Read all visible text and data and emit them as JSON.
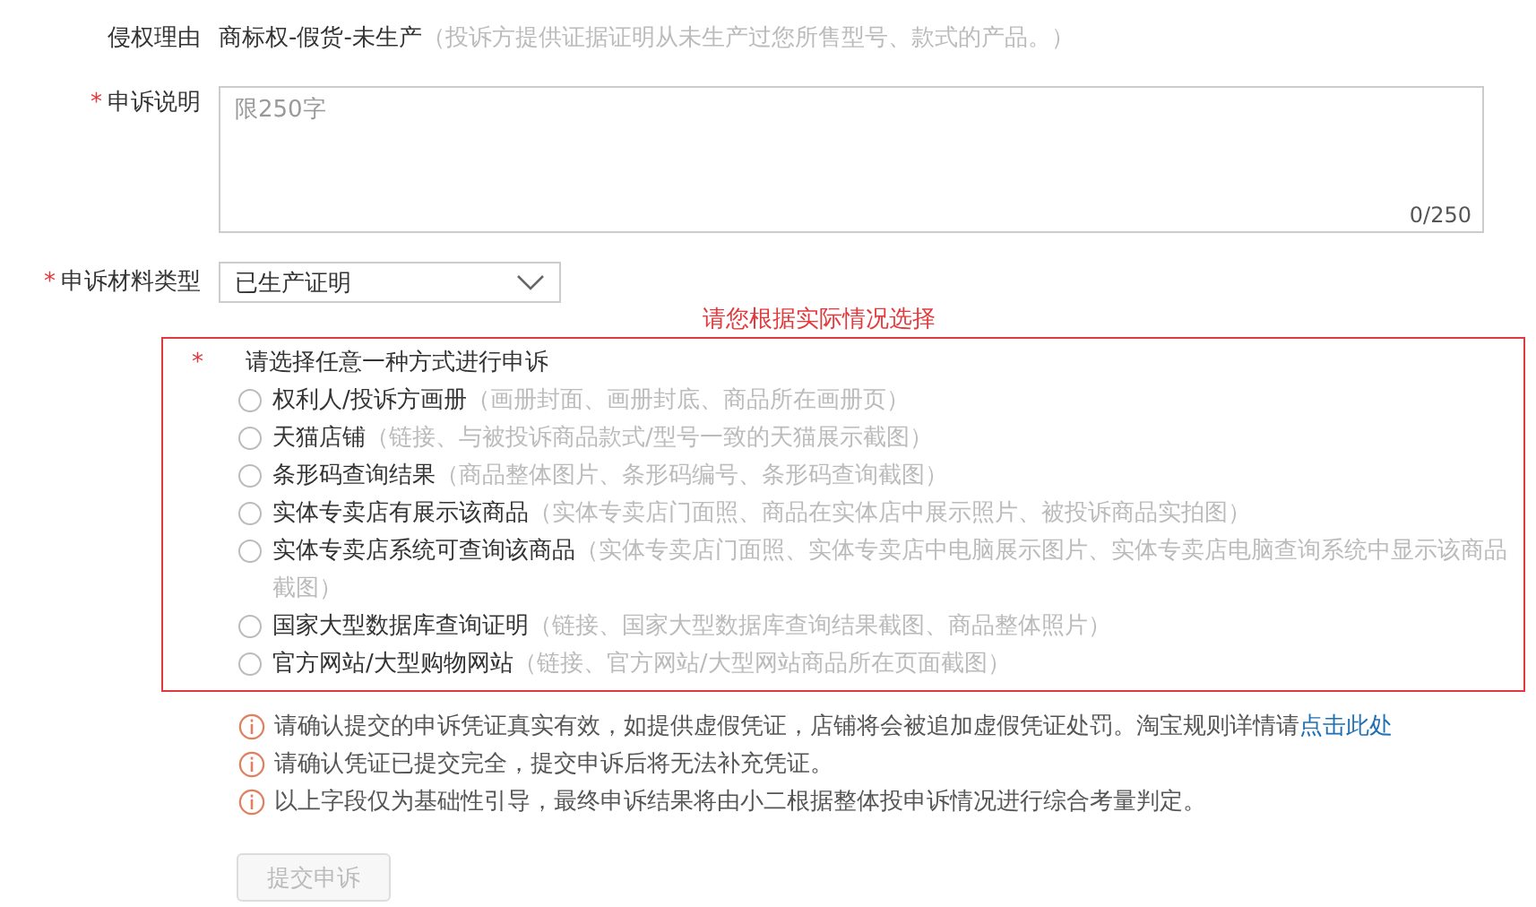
{
  "reason": {
    "label": "侵权理由",
    "value": "商标权-假货-未生产",
    "hint": "（投诉方提供证据证明从未生产过您所售型号、款式的产品。）"
  },
  "description": {
    "label": "申诉说明",
    "marker": "*",
    "placeholder": "限250字",
    "counter": "0/250"
  },
  "material_type": {
    "label": "申诉材料类型",
    "marker": "*",
    "value": "已生产证明"
  },
  "annotation": "请您根据实际情况选择",
  "methods": {
    "title": "请选择任意一种方式进行申诉",
    "marker": "*",
    "options": [
      {
        "label": "权利人/投诉方画册",
        "hint": "（画册封面、画册封底、商品所在画册页）",
        "selected": false
      },
      {
        "label": "天猫店铺",
        "hint": "（链接、与被投诉商品款式/型号一致的天猫展示截图）",
        "selected": false
      },
      {
        "label": "条形码查询结果",
        "hint": "（商品整体图片、条形码编号、条形码查询截图）",
        "selected": false
      },
      {
        "label": "实体专卖店有展示该商品",
        "hint": "（实体专卖店门面照、商品在实体店中展示照片、被投诉商品实拍图）",
        "selected": false
      },
      {
        "label": "实体专卖店系统可查询该商品",
        "hint": "（实体专卖店门面照、实体专卖店中电脑展示图片、实体专卖店电脑查询系统中显示该商品截图）",
        "selected": false
      },
      {
        "label": "国家大型数据库查询证明",
        "hint": "（链接、国家大型数据库查询结果截图、商品整体照片）",
        "selected": false
      },
      {
        "label": "官方网站/大型购物网站",
        "hint": "（链接、官方网站/大型网站商品所在页面截图）",
        "selected": false
      }
    ]
  },
  "notices": [
    {
      "text": "请确认提交的申诉凭证真实有效，如提供虚假凭证，店铺将会被追加虚假凭证处罚。淘宝规则详情请",
      "link": "点击此处"
    },
    {
      "text": "请确认凭证已提交完全，提交申诉后将无法补充凭证。"
    },
    {
      "text": "以上字段仅为基础性引导，最终申诉结果将由小二根据整体投申诉情况进行综合考量判定。"
    }
  ],
  "submit": {
    "label": "提交申诉",
    "disabled": true
  }
}
